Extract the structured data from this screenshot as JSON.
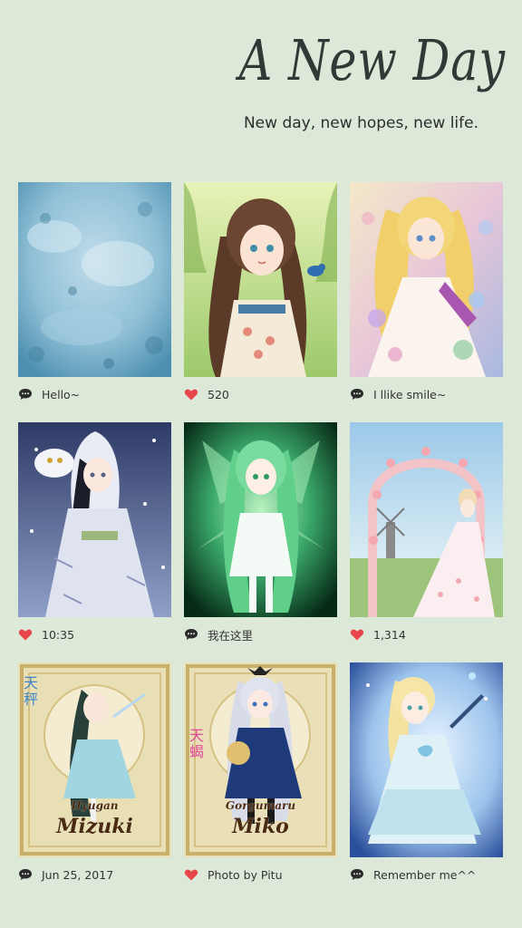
{
  "header": {
    "title": "A New Day",
    "subtitle": "New day, new hopes, new life."
  },
  "posts": [
    {
      "icon": "comment-icon",
      "caption": "Hello~",
      "art": "blue-texture"
    },
    {
      "icon": "heart-icon",
      "caption": "520",
      "art": "girl-with-bird"
    },
    {
      "icon": "comment-icon",
      "caption": "I llike smile~",
      "art": "flower-princess"
    },
    {
      "icon": "heart-icon",
      "caption": "10:35",
      "art": "winter-owl-girl"
    },
    {
      "icon": "comment-icon",
      "caption": "我在这里",
      "art": "green-fairy"
    },
    {
      "icon": "heart-icon",
      "caption": "1,314",
      "art": "wedding-arch"
    },
    {
      "icon": "comment-icon",
      "caption": "Jun 25, 2017",
      "art": "libra-card",
      "card_text": {
        "sign": "天秤",
        "small": "Hyugan",
        "big": "Mizuki"
      }
    },
    {
      "icon": "heart-icon",
      "caption": "Photo by Pitu",
      "art": "scorpio-card",
      "card_text": {
        "sign": "天蝎",
        "small": "Gorgumaru",
        "big": "Miko"
      }
    },
    {
      "icon": "comment-icon",
      "caption": "Remember me^^",
      "art": "blue-dress-girl"
    }
  ],
  "colors": {
    "background": "#dce9d8",
    "heart": "#e8464a",
    "comment": "#2b2b2b",
    "text": "#333333"
  }
}
